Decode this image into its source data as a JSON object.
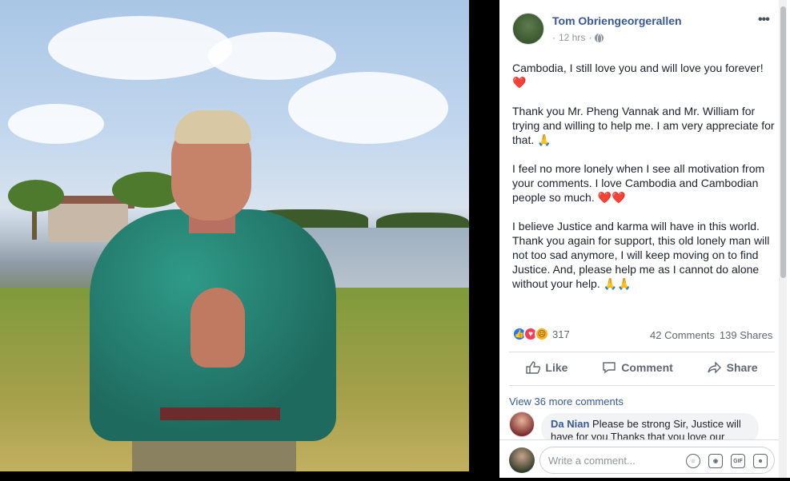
{
  "post": {
    "author": "Tom Obriengeorgerallen",
    "time": "12 hrs",
    "separator": "·",
    "more_label": "•••",
    "paragraphs": [
      "Cambodia, I still love you and will love you forever!",
      "Thank you Mr. Pheng Vannak and Mr. William for trying and willing to help me. I am very appreciate for that.",
      "I feel no more lonely when I see all motivation from your comments. I love Cambodia and Cambodian people so much.",
      "I believe Justice and karma will have in this world. Thank you again for support, this old lonely man will not too sad anymore, I will keep moving on to find Justice. And, please help me as I cannot do alone without your help."
    ],
    "emoji": {
      "heart": "❤️",
      "pray": "🙏",
      "two_hearts": "❤️❤️",
      "two_pray": "🙏🙏"
    }
  },
  "reactions": {
    "icons": [
      "like-icon",
      "love-icon",
      "sad-icon"
    ],
    "count": "317",
    "comments": "42 Comments",
    "shares": "139 Shares"
  },
  "actions": {
    "like": "Like",
    "comment": "Comment",
    "share": "Share"
  },
  "comments": {
    "view_more": "View 36 more comments",
    "items": [
      {
        "name": "Da Nian",
        "text": "Please be strong Sir, Justice will have for you Thanks that you love our small"
      }
    ]
  },
  "composer": {
    "placeholder": "Write a comment...",
    "icons": [
      "emoji-icon",
      "camera-icon",
      "gif-icon",
      "sticker-icon"
    ],
    "gif_label": "GIF"
  },
  "colors": {
    "link": "#385898",
    "text": "#1d2129",
    "muted": "#90949c",
    "like_blue": "#2078f4",
    "love_red": "#f33e58"
  }
}
